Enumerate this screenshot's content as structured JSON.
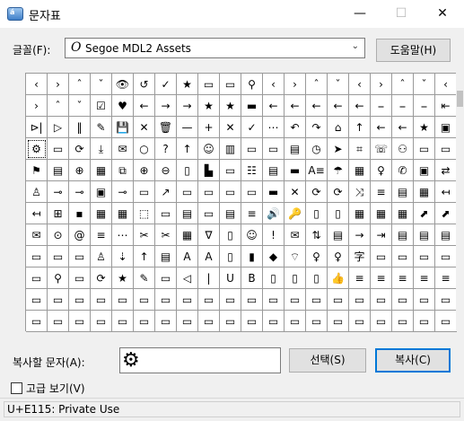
{
  "window": {
    "title": "문자표",
    "minimize": "—",
    "maximize": "☐",
    "close": "✕",
    "icon_text": "á"
  },
  "font": {
    "label": "글꼴(F):",
    "value": "Segoe MDL2 Assets",
    "icon_glyph": "O"
  },
  "help_button": "도움말(H)",
  "grid": [
    "‹",
    "›",
    "ˆ",
    "ˇ",
    "👁",
    "↺",
    "✓",
    "★",
    "▭",
    "▭",
    "⚲",
    "‹",
    "›",
    "ˆ",
    "ˇ",
    "‹",
    "›",
    "ˆ",
    "ˇ",
    "‹",
    "›",
    "ˆ",
    "ˇ",
    "☑",
    "♥",
    "←",
    "→",
    "→",
    "★",
    "★",
    "▬",
    "←",
    "←",
    "←",
    "←",
    "←",
    "⎯",
    "⎯",
    "⎯",
    "⇤",
    "⊳|",
    "▷",
    "‖",
    "✎",
    "💾",
    "✕",
    "🗑",
    "—",
    "+",
    "✕",
    "✓",
    "⋯",
    "↶",
    "↷",
    "⌂",
    "↑",
    "←",
    "←",
    "★",
    "▣",
    "⚙",
    "▭",
    "⟳",
    "⤓",
    "✉",
    "○",
    "?",
    "↑",
    "☺",
    "▥",
    "▭",
    "▭",
    "▤",
    "◷",
    "➤",
    "⌗",
    "☏",
    "⚇",
    "▭",
    "▭",
    "⚑",
    "▤",
    "⊕",
    "▦",
    "⧉",
    "⊕",
    "⊖",
    "▯",
    "▙",
    "▭",
    "☷",
    "▤",
    "▬",
    "A≡",
    "☂",
    "▦",
    "♀",
    "✆",
    "▣",
    "⇄",
    "♙",
    "⊸",
    "⊸",
    "▣",
    "⊸",
    "▭",
    "↗",
    "▭",
    "▭",
    "▭",
    "▭",
    "▬",
    "✕",
    "⟳",
    "⟳",
    "⤨",
    "≡",
    "▤",
    "▦",
    "↤",
    "↤",
    "⊞",
    "▪",
    "▦",
    "▦",
    "⬚",
    "▭",
    "▤",
    "▭",
    "▤",
    "≡",
    "🔊",
    "🔑",
    "▯",
    "▯",
    "▦",
    "▦",
    "▦",
    "⬈",
    "⬈",
    "✉",
    "⊙",
    "@",
    "≡",
    "⋯",
    "✂",
    "✂",
    "▦",
    "∇",
    "▯",
    "☺",
    "!",
    "✉",
    "⇅",
    "▤",
    "→",
    "⇥",
    "▤",
    "▤",
    "▤",
    "▭",
    "▭",
    "▭",
    "♙",
    "⇣",
    "↑",
    "▤",
    "A",
    "A",
    "▯",
    "▮",
    "◆",
    "⌔",
    "♀",
    "♀",
    "字",
    "▭",
    "▭",
    "▭",
    "▭",
    "▭",
    "⚲",
    "▭",
    "⟳",
    "★",
    "✎",
    "▭",
    "◁",
    "|",
    "U",
    "B",
    "▯",
    "▯",
    "▯",
    "👍",
    "≡",
    "≡",
    "≡",
    "≡",
    "≡",
    "▭",
    "▭",
    "▭",
    "▭",
    "▭",
    "▭",
    "▭",
    "▭",
    "▭",
    "▭",
    "▭",
    "▭",
    "▭",
    "▭",
    "▭",
    "▭",
    "▭",
    "▭",
    "▭",
    "▭",
    "▭",
    "▭",
    "▭",
    "▭",
    "▭",
    "▭",
    "▭",
    "▭",
    "▭",
    "▭",
    "▭",
    "▭",
    "▭",
    "▭",
    "▭",
    "▭",
    "▭",
    "▭",
    "▭",
    "▭"
  ],
  "selected_index": 60,
  "copy_label": "복사할 문자(A):",
  "copy_value": "⚙",
  "select_button": "선택(S)",
  "copy_button": "복사(C)",
  "advanced_label": "고급 보기(V)",
  "status": "U+E115: Private Use",
  "colors": {
    "accent": "#0078d7"
  }
}
